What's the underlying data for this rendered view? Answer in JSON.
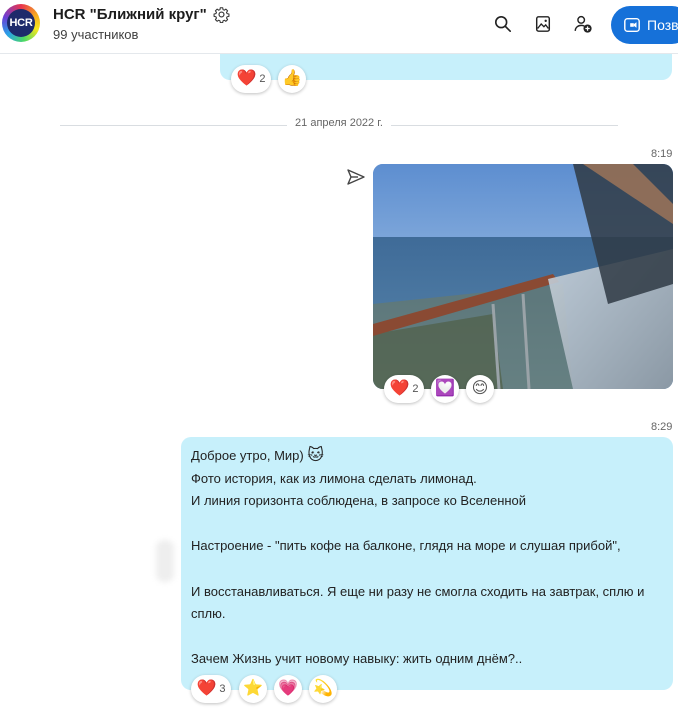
{
  "header": {
    "avatar_text": "HCR",
    "title": "HCR \"Ближний круг\"",
    "subtitle": "99 участников",
    "call_label": "Позв",
    "icons": [
      "search-icon",
      "gallery-icon",
      "add-person-icon",
      "video-call-icon",
      "gear-icon"
    ]
  },
  "previous_message": {
    "reactions": [
      {
        "emoji": "❤️",
        "count": "2"
      },
      {
        "emoji": "👍",
        "count": ""
      }
    ]
  },
  "date_separator": "21 апреля 2022 г.",
  "photo_message": {
    "time": "8:19",
    "reactions": [
      {
        "emoji": "❤️",
        "count": "2"
      },
      {
        "emoji": "💟",
        "count": ""
      },
      {
        "emoji": "😊",
        "count": ""
      }
    ]
  },
  "text_message": {
    "time": "8:29",
    "lines": {
      "l1": "Доброе утро, Мир)",
      "l1_emoji": "🐱",
      "l2": "Фото история, как из лимона сделать лимонад.",
      "l3": "И линия горизонта соблюдена, в запросе ко Вселенной",
      "l4": "Настроение - \"пить кофе на балконе, глядя на море и слушая прибой\",",
      "l5": "И восстанавливаться. Я еще ни разу не смогла сходить на завтрак, сплю и сплю.",
      "l6": "Зачем Жизнь учит новому навыку: жить одним днём?.."
    },
    "reactions": [
      {
        "emoji": "❤️",
        "count": "3"
      },
      {
        "emoji": "⭐",
        "count": ""
      },
      {
        "emoji": "💗",
        "count": ""
      },
      {
        "emoji": "💫",
        "count": ""
      }
    ]
  },
  "colors": {
    "bubble": "#c7f0fb",
    "accent": "#1671d9",
    "heart": "#e8263f"
  }
}
